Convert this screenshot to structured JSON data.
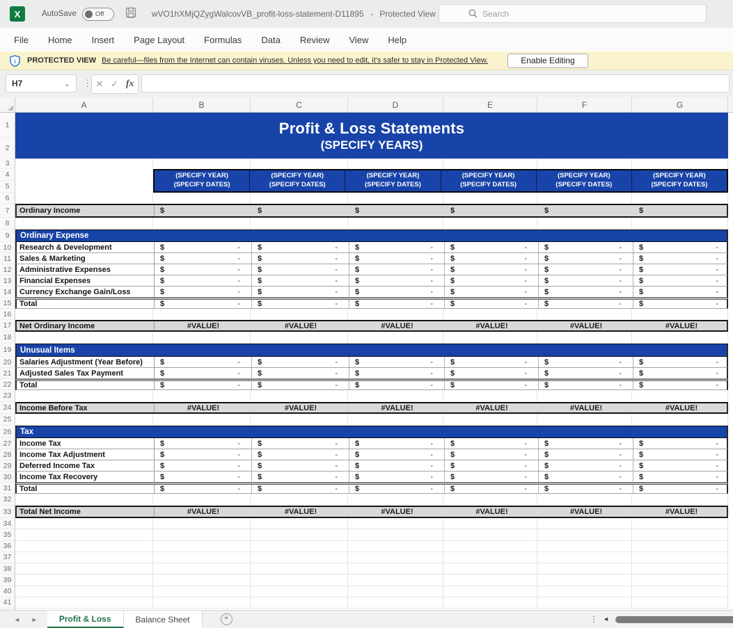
{
  "titlebar": {
    "app_logo": "X",
    "autosave_label": "AutoSave",
    "autosave_state": "Off",
    "filename": "wVO1hXMjQZygWalcovVB_profit-loss-statement-D11895",
    "separator": "-",
    "doc_mode": "Protected View",
    "search_placeholder": "Search"
  },
  "menu": {
    "items": [
      "File",
      "Home",
      "Insert",
      "Page Layout",
      "Formulas",
      "Data",
      "Review",
      "View",
      "Help"
    ]
  },
  "protected_banner": {
    "title": "PROTECTED VIEW",
    "message": "Be careful—files from the Internet can contain viruses. Unless you need to edit, it's safer to stay in Protected View.",
    "button_label": "Enable Editing"
  },
  "formula_bar": {
    "cell_ref": "H7",
    "formula_value": "",
    "icons": {
      "cancel": "✕",
      "enter": "✓",
      "fx": "fx"
    }
  },
  "grid": {
    "column_headers": [
      "A",
      "B",
      "C",
      "D",
      "E",
      "F",
      "G"
    ],
    "row_count": 41,
    "title": "Profit & Loss Statements",
    "subtitle": "(SPECIFY YEARS)",
    "year_header": {
      "line1": "(SPECIFY YEAR)",
      "line2": "(SPECIFY DATES)"
    },
    "value_columns": 6,
    "dollar": "$",
    "dash": "-",
    "error_value": "#VALUE!",
    "accent_blue": "#1843a8",
    "band_gray": "#d9d9d9",
    "rows": [
      {
        "rows": [
          1,
          2
        ],
        "type": "title"
      },
      {
        "rows": [
          3
        ],
        "type": "blank"
      },
      {
        "rows": [
          4,
          5
        ],
        "type": "yearhdr"
      },
      {
        "rows": [
          6
        ],
        "type": "blank"
      },
      {
        "rows": [
          7
        ],
        "type": "dollarband",
        "label": "Ordinary Income"
      },
      {
        "rows": [
          8
        ],
        "type": "blank"
      },
      {
        "rows": [
          9
        ],
        "type": "bluebanner",
        "label": "Ordinary Expense"
      },
      {
        "rows": [
          10
        ],
        "type": "money",
        "label": "Research & Development"
      },
      {
        "rows": [
          11
        ],
        "type": "money",
        "label": "Sales & Marketing"
      },
      {
        "rows": [
          12
        ],
        "type": "money",
        "label": "Administrative Expenses"
      },
      {
        "rows": [
          13
        ],
        "type": "money",
        "label": "Financial Expenses"
      },
      {
        "rows": [
          14
        ],
        "type": "money",
        "label": "Currency Exchange Gain/Loss"
      },
      {
        "rows": [
          15
        ],
        "type": "total",
        "label": "Total"
      },
      {
        "rows": [
          16
        ],
        "type": "blank"
      },
      {
        "rows": [
          17
        ],
        "type": "valueband",
        "label": "Net Ordinary Income"
      },
      {
        "rows": [
          18
        ],
        "type": "blank"
      },
      {
        "rows": [
          19
        ],
        "type": "bluebanner",
        "label": "Unusual Items"
      },
      {
        "rows": [
          20
        ],
        "type": "money",
        "label": "Salaries Adjustment (Year Before)"
      },
      {
        "rows": [
          21
        ],
        "type": "money",
        "label": "Adjusted Sales Tax Payment"
      },
      {
        "rows": [
          22
        ],
        "type": "total",
        "label": "Total"
      },
      {
        "rows": [
          23
        ],
        "type": "blank"
      },
      {
        "rows": [
          24
        ],
        "type": "valueband",
        "label": "Income Before Tax"
      },
      {
        "rows": [
          25
        ],
        "type": "blank"
      },
      {
        "rows": [
          26
        ],
        "type": "bluebanner",
        "label": "Tax"
      },
      {
        "rows": [
          27
        ],
        "type": "money",
        "label": "Income Tax"
      },
      {
        "rows": [
          28
        ],
        "type": "money",
        "label": "Income Tax Adjustment"
      },
      {
        "rows": [
          29
        ],
        "type": "money",
        "label": "Deferred Income Tax"
      },
      {
        "rows": [
          30
        ],
        "type": "money",
        "label": "Income Tax Recovery"
      },
      {
        "rows": [
          31
        ],
        "type": "total",
        "label": "Total"
      },
      {
        "rows": [
          32
        ],
        "type": "blank"
      },
      {
        "rows": [
          33
        ],
        "type": "valueband",
        "label": "Total Net Income"
      },
      {
        "rows": [
          34
        ],
        "type": "gridblank"
      },
      {
        "rows": [
          35
        ],
        "type": "gridblank"
      },
      {
        "rows": [
          36
        ],
        "type": "gridblank"
      },
      {
        "rows": [
          37
        ],
        "type": "gridblank"
      },
      {
        "rows": [
          38
        ],
        "type": "gridblank"
      },
      {
        "rows": [
          39
        ],
        "type": "gridblank"
      },
      {
        "rows": [
          40
        ],
        "type": "gridblank"
      },
      {
        "rows": [
          41
        ],
        "type": "gridblank"
      }
    ]
  },
  "sheet_tabs": {
    "tabs": [
      {
        "label": "Profit & Loss",
        "active": true
      },
      {
        "label": "Balance Sheet",
        "active": false
      }
    ],
    "add_label": "+"
  }
}
